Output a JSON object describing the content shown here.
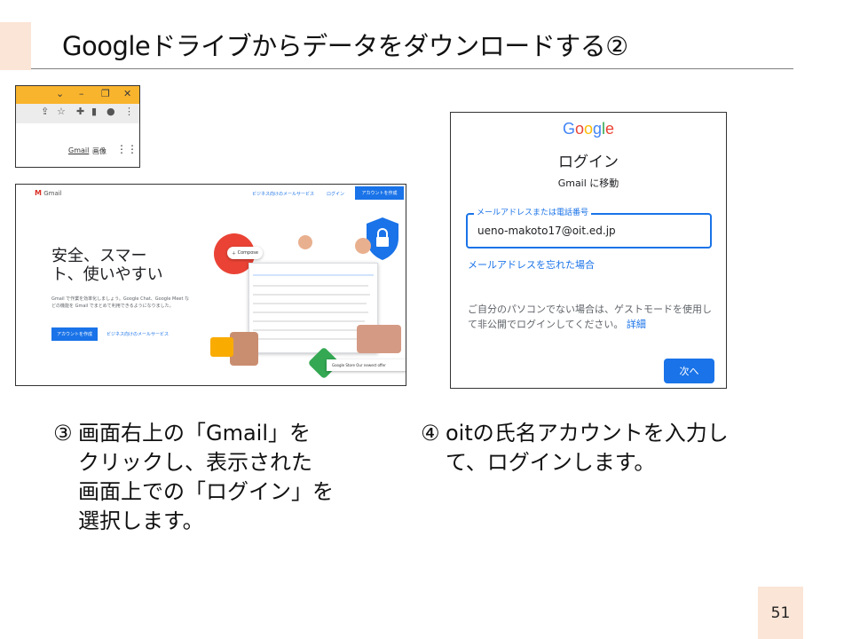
{
  "slide": {
    "title": "Googleドライブからデータをダウンロードする②",
    "page_number": "51"
  },
  "toolbar_crop": {
    "window_buttons": [
      "⌄",
      "–",
      "❐",
      "✕"
    ],
    "links": {
      "gmail": "Gmail",
      "images": "画像"
    }
  },
  "gmail_page": {
    "logo_text": "Gmail",
    "nav": {
      "business": "ビジネス向けのメールサービス",
      "login": "ログイン",
      "create_account": "アカウントを作成"
    },
    "headline": "安全、スマー\nト、使いやすい",
    "description": "Gmail で作業を効率化しましょう。Google Chat、Google Meet などの機能を Gmail でまとめて利用できるようになりました。",
    "create_account_button": "アカウントを作成",
    "business_link": "ビジネス向けのメールサービス",
    "compose_label": "Compose",
    "notification": "Google Store  Our newest offer"
  },
  "login_page": {
    "logo": [
      "G",
      "o",
      "o",
      "g",
      "l",
      "e"
    ],
    "logo_colors": [
      "#4285f4",
      "#ea4335",
      "#fbbc05",
      "#4285f4",
      "#34a853",
      "#ea4335"
    ],
    "title": "ログイン",
    "subtitle": "Gmail に移動",
    "field_label": "メールアドレスまたは電話番号",
    "field_value": "ueno-makoto17@oit.ed.jp",
    "forgot_link": "メールアドレスを忘れた場合",
    "guest_note": "ご自分のパソコンでない場合は、ゲストモードを使用して非公開でログインしてください。",
    "details_link": "詳細",
    "next_button": "次へ"
  },
  "captions": {
    "step3": {
      "marker": "③",
      "lines": [
        "画面右上の「Gmail」を",
        "クリックし、表示された",
        "画面上での「ログイン」を",
        "選択します。"
      ]
    },
    "step4": {
      "marker": "④",
      "lines": [
        "oitの氏名アカウントを入力し",
        "て、ログインします。"
      ]
    }
  }
}
